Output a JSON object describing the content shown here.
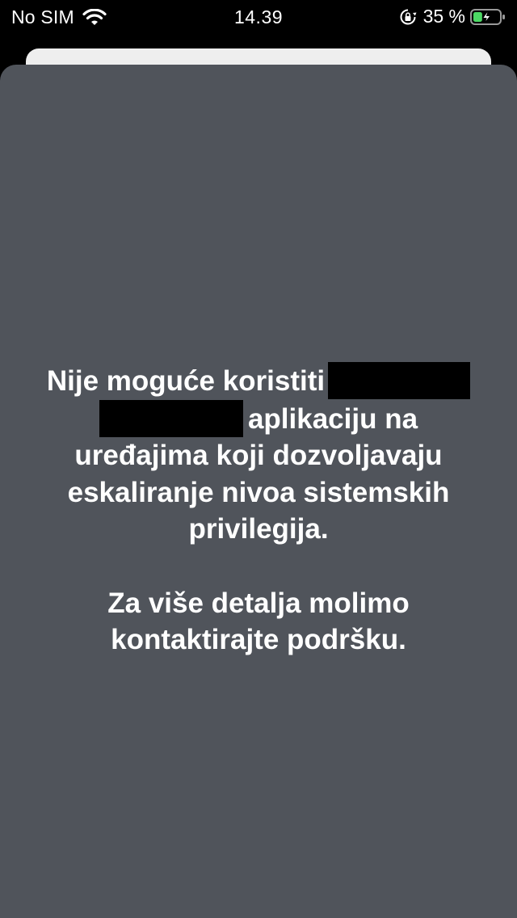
{
  "status_bar": {
    "carrier": "No SIM",
    "time": "14.39",
    "battery_percent": "35 %",
    "battery_level": 0.35,
    "battery_color": "#4cd964"
  },
  "message": {
    "line1_prefix": "Nije moguće koristiti",
    "line2_suffix": "aplikaciju na",
    "line3": "uređajima koji dozvoljavaju",
    "line4": "eskaliranje nivoa sistemskih",
    "line5": "privilegija.",
    "line6": "Za više detalja molimo",
    "line7": "kontaktirajte podršku."
  },
  "colors": {
    "sheet_background": "#50545b",
    "back_card": "#eeeeee",
    "redaction": "#000000"
  }
}
